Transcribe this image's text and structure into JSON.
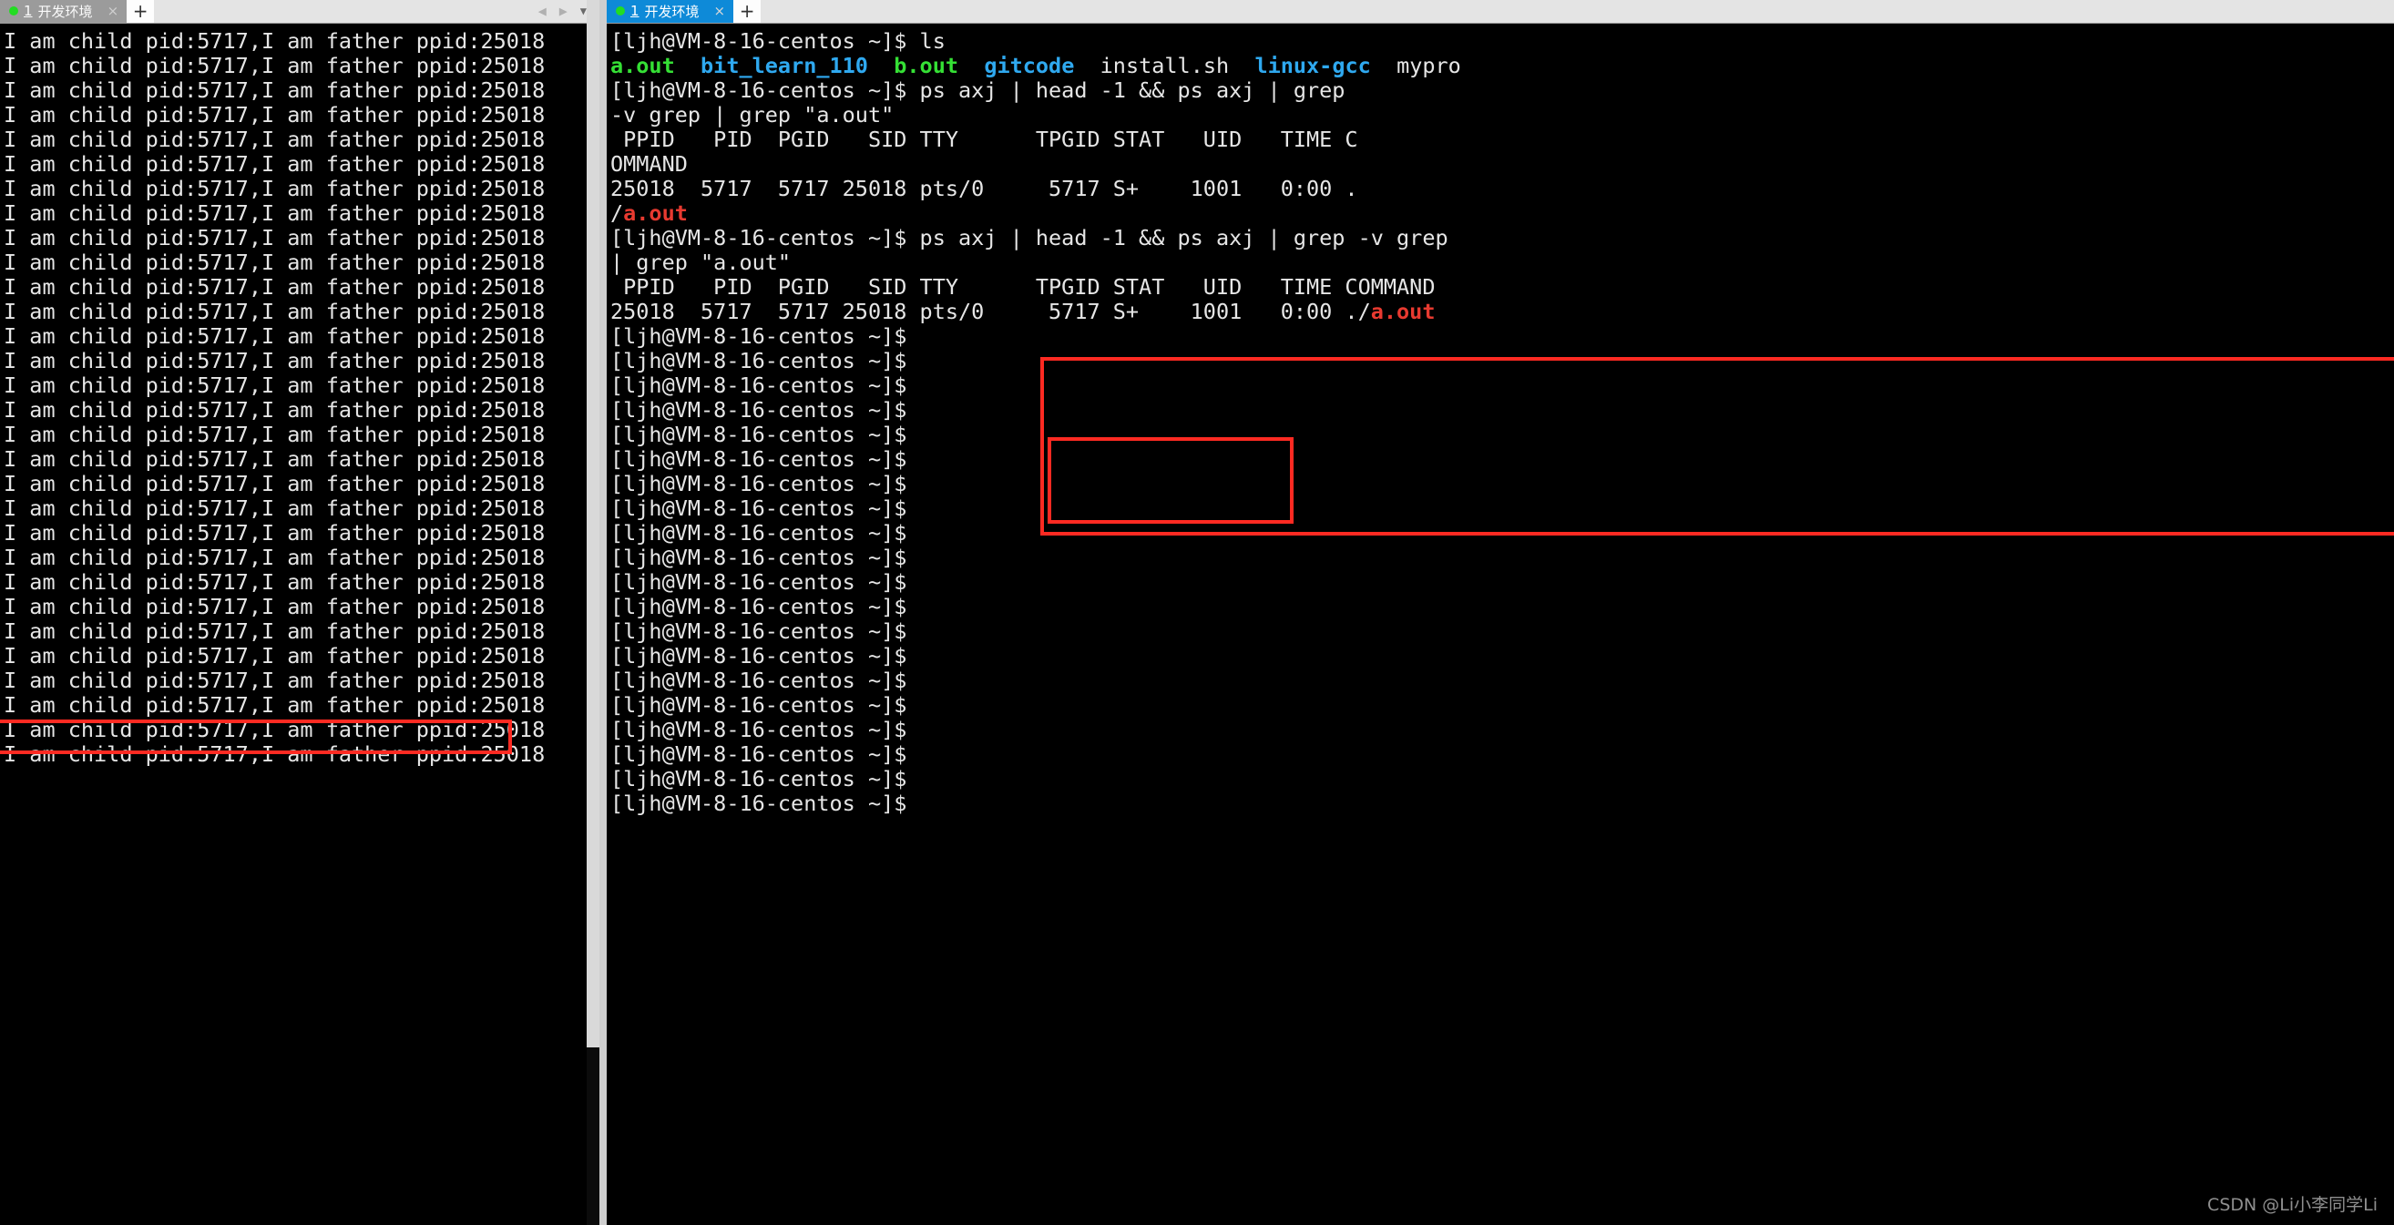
{
  "window": {
    "left_panel": {
      "tab": {
        "dot": "green-status-dot",
        "number": "1",
        "title": "开发环境",
        "close": "×"
      },
      "new_tab_label": "+",
      "nav_prev": "◀",
      "nav_next": "▶",
      "nav_menu": "▼"
    },
    "right_panel": {
      "tab": {
        "dot": "green-status-dot",
        "number": "1",
        "title": "开发环境",
        "close": "×"
      },
      "new_tab_label": "+"
    }
  },
  "colors": {
    "tab_active_bg": "#0e8ad8",
    "tab_inactive_bg": "#9b9b9b",
    "highlight_box": "#fe2a22",
    "dir_blue": "#2fa9f0",
    "exec_green": "#35e035",
    "exec_red": "#e83a30",
    "terminal_bg": "#000000",
    "terminal_fg": "#e6e6e6"
  },
  "left_terminal": {
    "repeat_line": "I am child pid:5717,I am father ppid:25018",
    "line_count": 30,
    "highlighted_line_index": 17
  },
  "right_terminal": {
    "prompt": "[ljh@VM-8-16-centos ~]$ ",
    "lines": [
      {
        "id": "cmd-ls",
        "segments": [
          {
            "text": "[ljh@VM-8-16-centos ~]$ ls",
            "color": "white"
          }
        ]
      },
      {
        "id": "ls-output",
        "segments": [
          {
            "text": "a.out",
            "color": "green"
          },
          {
            "text": "  ",
            "color": "white"
          },
          {
            "text": "bit_learn_110",
            "color": "cyan"
          },
          {
            "text": "  ",
            "color": "white"
          },
          {
            "text": "b.out",
            "color": "green"
          },
          {
            "text": "  ",
            "color": "white"
          },
          {
            "text": "gitcode",
            "color": "cyan"
          },
          {
            "text": "  ",
            "color": "white"
          },
          {
            "text": "install.sh",
            "color": "white"
          },
          {
            "text": "  ",
            "color": "white"
          },
          {
            "text": "linux-gcc",
            "color": "cyan"
          },
          {
            "text": "  ",
            "color": "white"
          },
          {
            "text": "mypro",
            "color": "white"
          }
        ]
      },
      {
        "id": "cmd-ps-1a",
        "segments": [
          {
            "text": "[ljh@VM-8-16-centos ~]$ ps axj | head -1 && ps axj | grep",
            "color": "white"
          }
        ]
      },
      {
        "id": "cmd-ps-1b",
        "segments": [
          {
            "text": "-v grep | grep \"a.out\"",
            "color": "white"
          }
        ]
      },
      {
        "id": "ps-header-1a",
        "segments": [
          {
            "text": " PPID   PID  PGID   SID TTY      TPGID STAT   UID   TIME C",
            "color": "white"
          }
        ]
      },
      {
        "id": "ps-header-1b",
        "segments": [
          {
            "text": "OMMAND",
            "color": "white"
          }
        ]
      },
      {
        "id": "ps-row-1a",
        "segments": [
          {
            "text": "25018  5717  5717 25018 pts/0     5717 S+    1001   0:00 .",
            "color": "white"
          }
        ]
      },
      {
        "id": "ps-row-1b",
        "segments": [
          {
            "text": "/",
            "color": "white"
          },
          {
            "text": "a.out",
            "color": "red"
          }
        ]
      },
      {
        "id": "cmd-ps-2a",
        "segments": [
          {
            "text": "[ljh@VM-8-16-centos ~]$ ps axj | head -1 && ps axj | grep -v grep",
            "color": "white"
          }
        ]
      },
      {
        "id": "cmd-ps-2b",
        "segments": [
          {
            "text": "| grep \"a.out\"",
            "color": "white"
          }
        ]
      },
      {
        "id": "ps-header-2",
        "segments": [
          {
            "text": " PPID   PID  PGID   SID TTY      TPGID STAT   UID   TIME COMMAND",
            "color": "white"
          }
        ]
      },
      {
        "id": "ps-row-2",
        "segments": [
          {
            "text": "25018  5717  5717 25018 pts/0     5717 S+    1001   0:00 ./",
            "color": "white"
          },
          {
            "text": "a.out",
            "color": "red"
          }
        ]
      },
      {
        "id": "prompt-1",
        "segments": [
          {
            "text": "[ljh@VM-8-16-centos ~]$",
            "color": "white"
          }
        ]
      },
      {
        "id": "prompt-2",
        "segments": [
          {
            "text": "[ljh@VM-8-16-centos ~]$",
            "color": "white"
          }
        ]
      },
      {
        "id": "prompt-3",
        "segments": [
          {
            "text": "[ljh@VM-8-16-centos ~]$",
            "color": "white"
          }
        ]
      },
      {
        "id": "prompt-4",
        "segments": [
          {
            "text": "[ljh@VM-8-16-centos ~]$",
            "color": "white"
          }
        ]
      },
      {
        "id": "prompt-5",
        "segments": [
          {
            "text": "[ljh@VM-8-16-centos ~]$",
            "color": "white"
          }
        ]
      },
      {
        "id": "prompt-6",
        "segments": [
          {
            "text": "[ljh@VM-8-16-centos ~]$",
            "color": "white"
          }
        ]
      },
      {
        "id": "prompt-7",
        "segments": [
          {
            "text": "[ljh@VM-8-16-centos ~]$",
            "color": "white"
          }
        ]
      },
      {
        "id": "prompt-8",
        "segments": [
          {
            "text": "[ljh@VM-8-16-centos ~]$",
            "color": "white"
          }
        ]
      },
      {
        "id": "prompt-9",
        "segments": [
          {
            "text": "[ljh@VM-8-16-centos ~]$",
            "color": "white"
          }
        ]
      },
      {
        "id": "prompt-10",
        "segments": [
          {
            "text": "[ljh@VM-8-16-centos ~]$",
            "color": "white"
          }
        ]
      },
      {
        "id": "prompt-11",
        "segments": [
          {
            "text": "[ljh@VM-8-16-centos ~]$",
            "color": "white"
          }
        ]
      },
      {
        "id": "prompt-12",
        "segments": [
          {
            "text": "[ljh@VM-8-16-centos ~]$",
            "color": "white"
          }
        ]
      },
      {
        "id": "prompt-13",
        "segments": [
          {
            "text": "[ljh@VM-8-16-centos ~]$",
            "color": "white"
          }
        ]
      },
      {
        "id": "prompt-14",
        "segments": [
          {
            "text": "[ljh@VM-8-16-centos ~]$",
            "color": "white"
          }
        ]
      },
      {
        "id": "prompt-15",
        "segments": [
          {
            "text": "[ljh@VM-8-16-centos ~]$",
            "color": "white"
          }
        ]
      },
      {
        "id": "prompt-16",
        "segments": [
          {
            "text": "[ljh@VM-8-16-centos ~]$",
            "color": "white"
          }
        ]
      },
      {
        "id": "prompt-17",
        "segments": [
          {
            "text": "[ljh@VM-8-16-centos ~]$",
            "color": "white"
          }
        ]
      },
      {
        "id": "prompt-18",
        "segments": [
          {
            "text": "[ljh@VM-8-16-centos ~]$",
            "color": "white"
          }
        ]
      },
      {
        "id": "prompt-19",
        "segments": [
          {
            "text": "[ljh@VM-8-16-centos ~]$",
            "color": "white"
          }
        ]
      },
      {
        "id": "prompt-20",
        "segments": [
          {
            "text": "[ljh@VM-8-16-centos ~]$",
            "color": "white"
          }
        ]
      }
    ]
  },
  "watermark": {
    "text": "CSDN @Li小李同学Li"
  }
}
